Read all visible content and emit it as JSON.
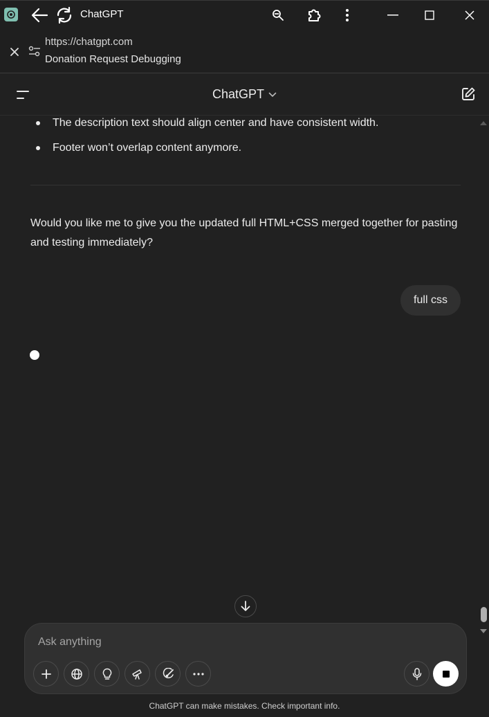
{
  "window": {
    "title": "ChatGPT",
    "icons": [
      "app-logo",
      "back-arrow-icon",
      "reload-icon",
      "zoom-icon",
      "extension-icon",
      "more-vertical-icon",
      "minimize-icon",
      "maximize-icon",
      "close-icon"
    ]
  },
  "urlbar": {
    "url": "https://chatgpt.com",
    "page_title": "Donation Request Debugging"
  },
  "header": {
    "title": "ChatGPT"
  },
  "conversation": {
    "bullets": [
      "The description text should align center and have consistent width.",
      "Footer won’t overlap content anymore."
    ],
    "assistant_question": "Would you like me to give you the updated full HTML+CSS merged together for pasting and testing immediately?",
    "user_message": "full css"
  },
  "composer": {
    "placeholder": "Ask anything",
    "tools": [
      "plus-icon",
      "globe-icon",
      "lightbulb-icon",
      "telescope-icon",
      "paint-brush-icon",
      "more-horizontal-icon"
    ]
  },
  "footer": {
    "disclaimer": "ChatGPT can make mistakes. Check important info."
  },
  "colors": {
    "background": "#212121",
    "chrome": "#1f1f1f",
    "bubble": "#303030",
    "text": "#ececec"
  }
}
